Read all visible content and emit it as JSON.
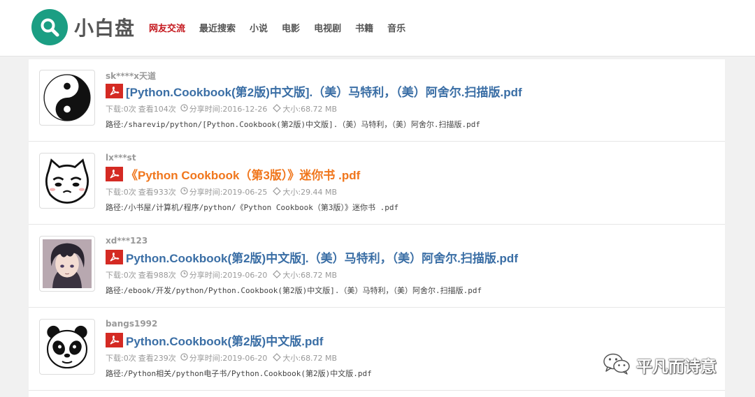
{
  "header": {
    "site_name": "小白盘",
    "nav": [
      {
        "label": "网友交流",
        "active": true
      },
      {
        "label": "最近搜索",
        "active": false
      },
      {
        "label": "小说",
        "active": false
      },
      {
        "label": "电影",
        "active": false
      },
      {
        "label": "电视剧",
        "active": false
      },
      {
        "label": "书籍",
        "active": false
      },
      {
        "label": "音乐",
        "active": false
      }
    ]
  },
  "results": [
    {
      "user": "sk****x天道",
      "title": "[Python.Cookbook(第2版)中文版].（美）马特利，（美）阿舍尔.扫描版.pdf",
      "downloads": "下载:0次",
      "views": "查看104次",
      "share_time": "分享时间:2016-12-26",
      "size": "大小:68.72 MB",
      "path_label": "路径:",
      "path": "/sharevip/python/[Python.Cookbook(第2版)中文版].（美）马特利，（美）阿舍尔.扫描版.pdf",
      "avatar": "yin-yang-avatar"
    },
    {
      "user": "lx***st",
      "title": "《Python Cookbook（第3版）》迷你书 .pdf",
      "downloads": "下载:0次",
      "views": "查看933次",
      "share_time": "分享时间:2019-06-25",
      "size": "大小:29.44 MB",
      "path_label": "路径:",
      "path": "/小书屋/计算机/程序/python/《Python Cookbook（第3版）》迷你书 .pdf",
      "avatar": "cartoon-face-avatar"
    },
    {
      "user": "xd***123",
      "title": "Python.Cookbook(第2版)中文版].（美）马特利，（美）阿舍尔.扫描版.pdf",
      "downloads": "下载:0次",
      "views": "查看988次",
      "share_time": "分享时间:2019-06-20",
      "size": "大小:68.72 MB",
      "path_label": "路径:",
      "path": "/ebook/开发/python/Python.Cookbook(第2版)中文版].（美）马特利，（美）阿舍尔.扫描版.pdf",
      "avatar": "anime-avatar"
    },
    {
      "user": "bangs1992",
      "title": "Python.Cookbook(第2版)中文版.pdf",
      "downloads": "下载:0次",
      "views": "查看239次",
      "share_time": "分享时间:2019-06-20",
      "size": "大小:68.72 MB",
      "path_label": "路径:",
      "path": "/Python相关/python电子书/Python.Cookbook(第2版)中文版.pdf",
      "avatar": "panda-avatar"
    }
  ],
  "watermark": {
    "text": "平凡而诗意",
    "icon": "wechat-icon"
  },
  "colors": {
    "brand": "#1b9e83",
    "nav_active": "#c4161c",
    "title_link": "#3a6ea5",
    "title_highlight": "#f0761c",
    "pdf_icon": "#d42a23"
  }
}
